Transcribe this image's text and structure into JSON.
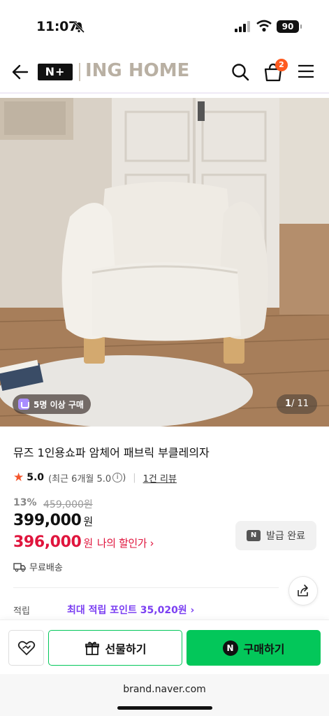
{
  "status_bar": {
    "time": "11:07",
    "battery": "90"
  },
  "header": {
    "brand_logo": "N+",
    "store_name": "ING HOME",
    "cart_count": "2"
  },
  "product": {
    "purchase_chip": "5명 이상 구매",
    "pager_current": "1",
    "pager_total": "/ 11",
    "title": "뮤즈 1인용쇼파 암체어 패브릭 부클레의자",
    "rating_score": "5.0",
    "rating_period": "(최근 6개월 5.0",
    "rating_info": "i",
    "rating_period_close": ")",
    "review_count": "1건 리뷰",
    "discount_rate": "13%",
    "original_price": "459,000원",
    "sale_price": "399,000",
    "sale_unit": "원",
    "my_price": "396,000",
    "my_price_unit": "원",
    "my_price_label": "나의 할인가 ›",
    "coupon_icon": "N",
    "coupon_label": "발급 완료",
    "shipping": "무료배송",
    "points_label": "적립",
    "points_value": "최대 적립 포인트 35,020원 ›"
  },
  "actions": {
    "gift_label": "선물하기",
    "buy_icon": "N",
    "buy_label": "구매하기"
  },
  "browser": {
    "url": "brand.naver.com"
  },
  "colors": {
    "accent_green": "#03c75a",
    "sale_red": "#e0153d",
    "points_purple": "#7b3ff2",
    "star_orange": "#f4552b"
  }
}
